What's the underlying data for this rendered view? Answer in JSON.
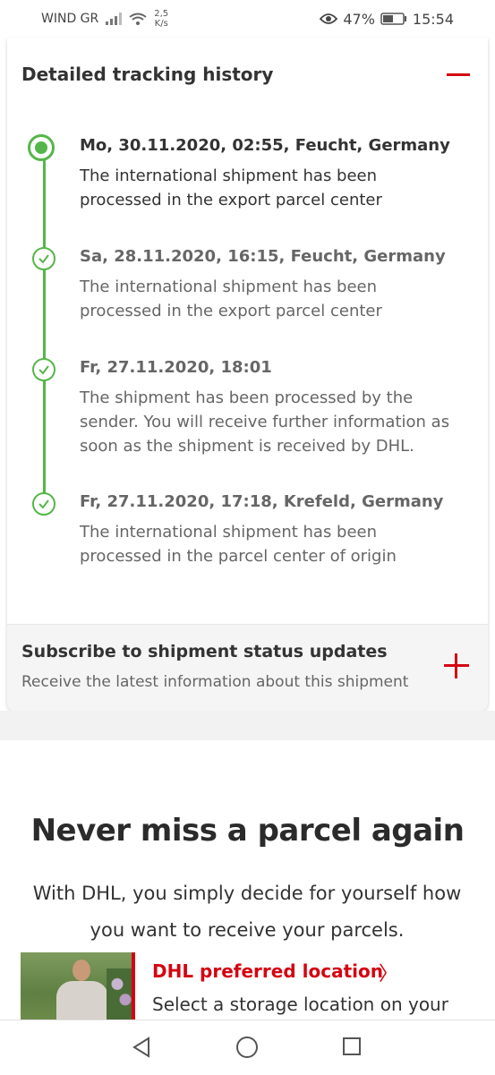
{
  "status_bar": {
    "carrier": "WIND GR",
    "speed_value": "2,5",
    "speed_unit": "K/s",
    "battery": "47%",
    "time": "15:54",
    "icons": [
      "signal-icon",
      "wifi-icon",
      "eye-icon",
      "battery-icon"
    ]
  },
  "tracking": {
    "title": "Detailed tracking history",
    "collapse_icon": "minus-icon",
    "events": [
      {
        "date": "Mo, 30.11.2020, 02:55, Feucht, Germany",
        "line1": "The international shipment has been",
        "line2": "processed in the export parcel center"
      },
      {
        "date": "Sa, 28.11.2020, 16:15, Feucht, Germany",
        "line1": "The international shipment has been",
        "line2": "processed in the export parcel center"
      },
      {
        "date": "Fr, 27.11.2020, 18:01",
        "line1": "The shipment has been processed by the",
        "line2": "sender. You will receive further information as",
        "line3": "soon as the shipment is received by DHL."
      },
      {
        "date": "Fr, 27.11.2020, 17:18, Krefeld, Germany",
        "line1": "The international shipment has been",
        "line2": "processed in the parcel center of origin"
      }
    ]
  },
  "subscribe": {
    "title": "Subscribe to shipment status updates",
    "description": "Receive the latest information about this shipment",
    "expand_icon": "plus-icon"
  },
  "promo": {
    "title": "Never miss a parcel again",
    "text_line1": "With DHL, you simply decide for yourself how",
    "text_line2": "you want to receive your parcels.",
    "location_title": "DHL preferred location",
    "location_chevron": "〉",
    "location_desc": "Select a storage location on your"
  },
  "colors": {
    "accent_red": "#d40511",
    "timeline_green": "#55b649"
  }
}
